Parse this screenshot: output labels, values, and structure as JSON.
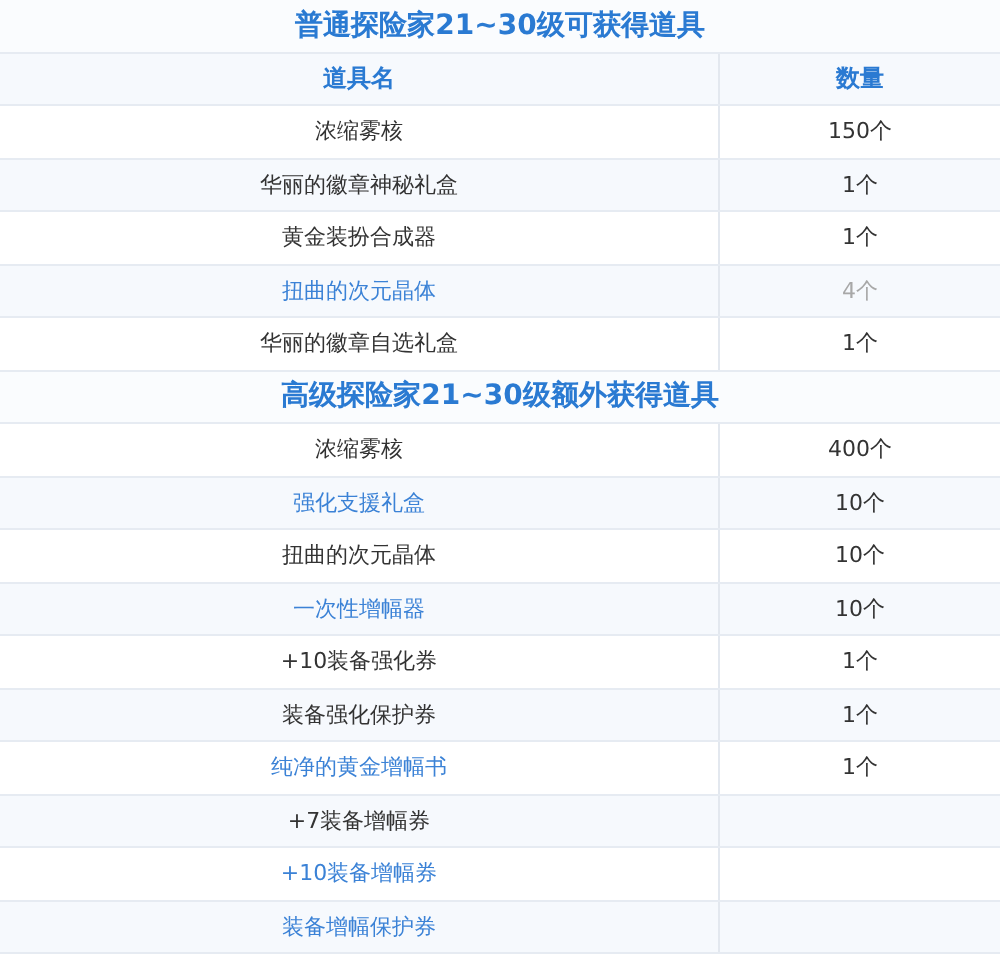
{
  "sections": [
    {
      "title": "普通探险家21~30级可获得道具",
      "columns": [
        "道具名",
        "数量"
      ],
      "rows": [
        {
          "name": "浓缩雾核",
          "qty": "150个",
          "link": false,
          "dim": false
        },
        {
          "name": "华丽的徽章神秘礼盒",
          "qty": "1个",
          "link": false,
          "dim": false
        },
        {
          "name": "黄金装扮合成器",
          "qty": "1个",
          "link": false,
          "dim": false
        },
        {
          "name": "扭曲的次元晶体",
          "qty": "4个",
          "link": true,
          "dim": true
        },
        {
          "name": "华丽的徽章自选礼盒",
          "qty": "1个",
          "link": false,
          "dim": false
        }
      ]
    },
    {
      "title": "高级探险家21~30级额外获得道具",
      "rows": [
        {
          "name": "浓缩雾核",
          "qty": "400个",
          "link": false,
          "dim": false
        },
        {
          "name": "强化支援礼盒",
          "qty": "10个",
          "link": true,
          "dim": false
        },
        {
          "name": "扭曲的次元晶体",
          "qty": "10个",
          "link": false,
          "dim": false
        },
        {
          "name": "一次性增幅器",
          "qty": "10个",
          "link": true,
          "dim": false
        },
        {
          "name": "+10装备强化券",
          "qty": "1个",
          "link": false,
          "dim": false
        },
        {
          "name": "装备强化保护券",
          "qty": "1个",
          "link": false,
          "dim": false
        },
        {
          "name": "纯净的黄金增幅书",
          "qty": "1个",
          "link": true,
          "dim": false
        },
        {
          "name": "+7装备增幅券",
          "link": false
        },
        {
          "name": "+10装备增幅券",
          "link": true
        },
        {
          "name": "装备增幅保护券",
          "link": true
        }
      ]
    }
  ]
}
